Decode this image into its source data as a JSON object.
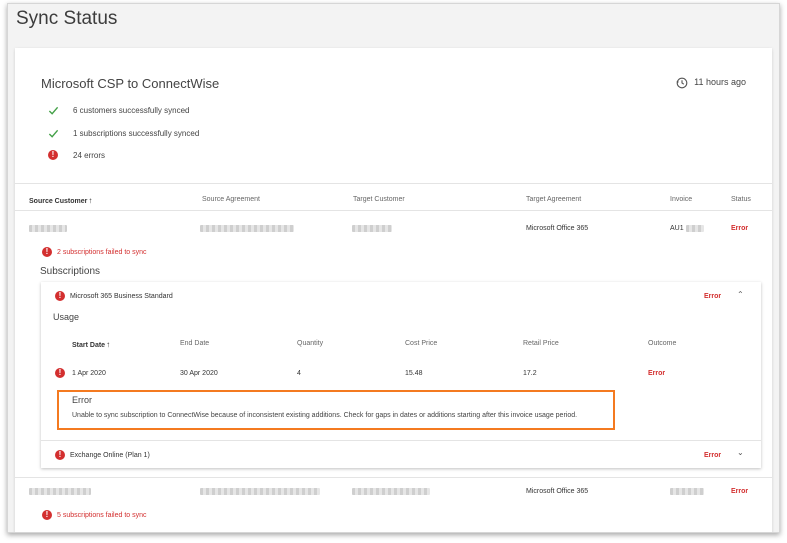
{
  "page": {
    "title": "Sync Status"
  },
  "sync": {
    "title": "Microsoft CSP to ConnectWise",
    "last_sync": "11 hours ago",
    "stats": [
      {
        "text": "6 customers successfully synced",
        "type": "success"
      },
      {
        "text": "1 subscriptions successfully synced",
        "type": "success"
      },
      {
        "text": "24 errors",
        "type": "error"
      }
    ]
  },
  "table": {
    "columns": [
      "Source Customer",
      "Source Agreement",
      "Target Customer",
      "Target Agreement",
      "Invoice",
      "Status"
    ],
    "rows": [
      {
        "target_agreement": "Microsoft Office 365",
        "invoice": "AU1",
        "status": "Error",
        "failed_text": "2 subscriptions failed to sync"
      },
      {
        "target_agreement": "Microsoft Office 365",
        "invoice": "",
        "status": "Error",
        "failed_text": "5 subscriptions failed to sync"
      }
    ]
  },
  "subscriptions": {
    "heading": "Subscriptions",
    "items": [
      {
        "name": "Microsoft 365 Business Standard",
        "status": "Error"
      },
      {
        "name": "Exchange Online (Plan 1)",
        "status": "Error"
      }
    ],
    "usage": {
      "heading": "Usage",
      "columns": [
        "Start Date",
        "End Date",
        "Quantity",
        "Cost Price",
        "Retail Price",
        "Outcome"
      ],
      "row": {
        "start": "1 Apr 2020",
        "end": "30 Apr 2020",
        "quantity": "4",
        "cost": "15.48",
        "retail": "17.2",
        "outcome": "Error"
      }
    },
    "error": {
      "title": "Error",
      "message": "Unable to sync subscription to ConnectWise because of inconsistent existing additions. Check for gaps in dates or additions starting after this invoice usage period."
    }
  },
  "colors": {
    "error": "#d32f2f",
    "success": "#43a047",
    "highlight": "#f47a20"
  },
  "icons": [
    "history-icon",
    "check-icon",
    "error-icon",
    "sort-arrow-up-icon",
    "chevron-up-icon",
    "chevron-down-icon"
  ]
}
